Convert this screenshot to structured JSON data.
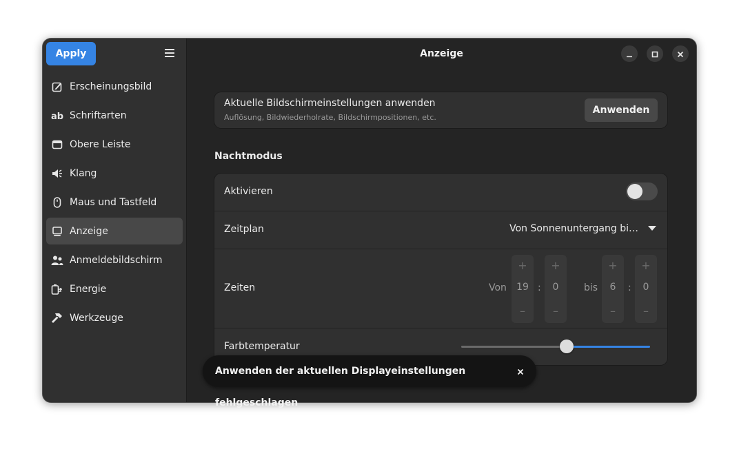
{
  "sidebar": {
    "apply_label": "Apply",
    "menu_icon": "hamburger-menu-icon",
    "items": [
      {
        "label": "Erscheinungsbild",
        "icon": "appearance-icon",
        "active": false
      },
      {
        "label": "Schriftarten",
        "icon": "fonts-icon",
        "active": false
      },
      {
        "label": "Obere Leiste",
        "icon": "top-bar-icon",
        "active": false
      },
      {
        "label": "Klang",
        "icon": "sound-icon",
        "active": false
      },
      {
        "label": "Maus und Tastfeld",
        "icon": "mouse-icon",
        "active": false
      },
      {
        "label": "Anzeige",
        "icon": "display-icon",
        "active": true
      },
      {
        "label": "Anmeldebildschirm",
        "icon": "login-screen-icon",
        "active": false
      },
      {
        "label": "Energie",
        "icon": "power-icon",
        "active": false
      },
      {
        "label": "Werkzeuge",
        "icon": "tools-icon",
        "active": false
      }
    ]
  },
  "header": {
    "title": "Anzeige",
    "controls": [
      "minimize-icon",
      "maximize-icon",
      "close-icon"
    ]
  },
  "apply_card": {
    "title": "Aktuelle Bildschirmeinstellungen anwenden",
    "subtitle": "Auflösung, Bildwiederholrate, Bildschirmpositionen, etc.",
    "button_label": "Anwenden"
  },
  "night_mode": {
    "section_title": "Nachtmodus",
    "activate_label": "Aktivieren",
    "activate_on": false,
    "schedule_label": "Zeitplan",
    "schedule_value": "Von Sonnenuntergang bi…",
    "times_label": "Zeiten",
    "from_label": "Von",
    "from_hour": "19",
    "from_minute": "0",
    "to_label": "bis",
    "to_hour": "6",
    "to_minute": "0",
    "separator": ":",
    "plus": "+",
    "minus": "–",
    "temperature_label": "Farbtemperatur",
    "temperature_level": 0.56
  },
  "toast": {
    "message": "Anwenden der aktuellen Displayeinstellungen fehlgeschlagen"
  },
  "colors": {
    "accent": "#3584e4",
    "window_bg": "#242424",
    "sidebar_bg": "#303030"
  }
}
